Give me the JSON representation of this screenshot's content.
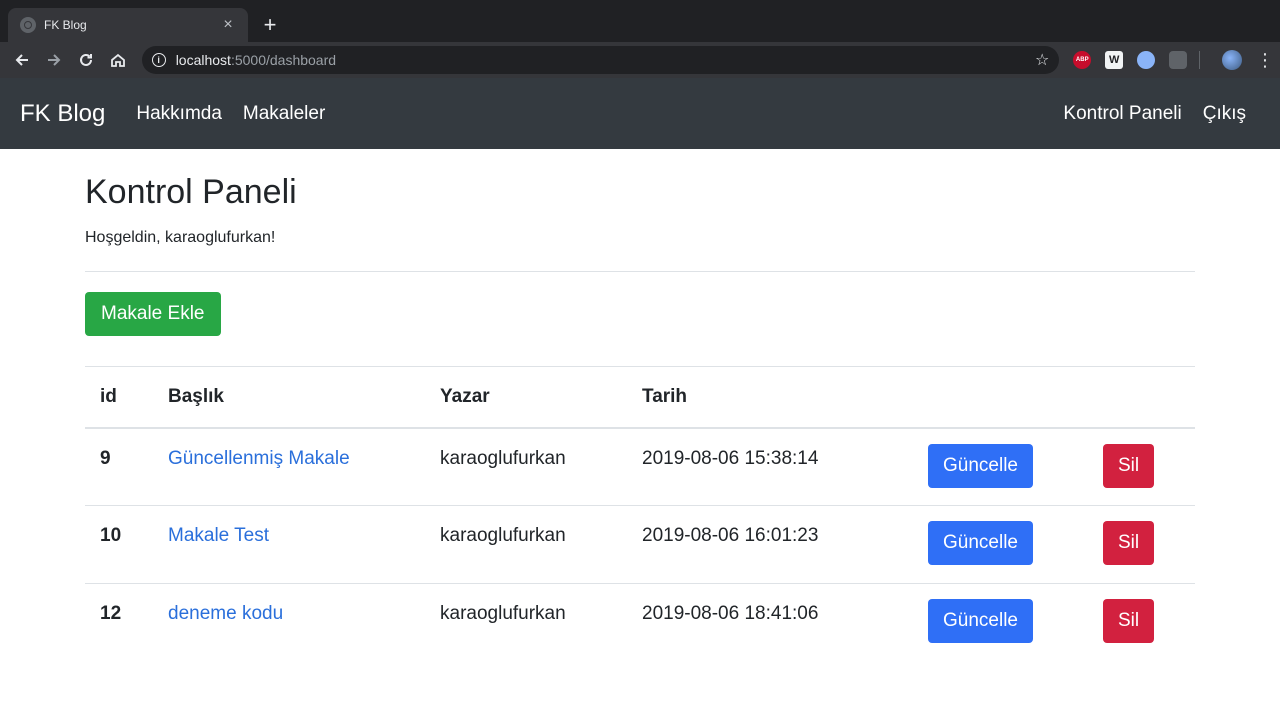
{
  "browser": {
    "tab_title": "FK Blog",
    "close_glyph": "×",
    "newtab_glyph": "+",
    "url_host": "localhost",
    "url_path": ":5000/dashboard",
    "info_glyph": "i",
    "star_glyph": "☆",
    "ext_abp": "ABP",
    "ext_w": "W",
    "menu_glyph": "⋮"
  },
  "navbar": {
    "brand": "FK Blog",
    "left_links": [
      "Hakkımda",
      "Makaleler"
    ],
    "right_links": [
      "Kontrol Paneli",
      "Çıkış"
    ]
  },
  "page": {
    "title": "Kontrol Paneli",
    "welcome": "Hoşgeldin, karaoglufurkan!",
    "add_button": "Makale Ekle"
  },
  "table": {
    "headers": [
      "id",
      "Başlık",
      "Yazar",
      "Tarih"
    ],
    "rows": [
      {
        "id": "9",
        "title": "Güncellenmiş Makale",
        "author": "karaoglufurkan",
        "date": "2019-08-06 15:38:14"
      },
      {
        "id": "10",
        "title": "Makale Test",
        "author": "karaoglufurkan",
        "date": "2019-08-06 16:01:23"
      },
      {
        "id": "12",
        "title": "deneme kodu",
        "author": "karaoglufurkan",
        "date": "2019-08-06 18:41:06"
      }
    ],
    "update_label": "Güncelle",
    "delete_label": "Sil"
  },
  "colors": {
    "navbar_bg": "#343a40",
    "success": "#28a745",
    "primary": "#2f6ff6",
    "danger": "#d2213f",
    "link": "#2a6fdb"
  }
}
